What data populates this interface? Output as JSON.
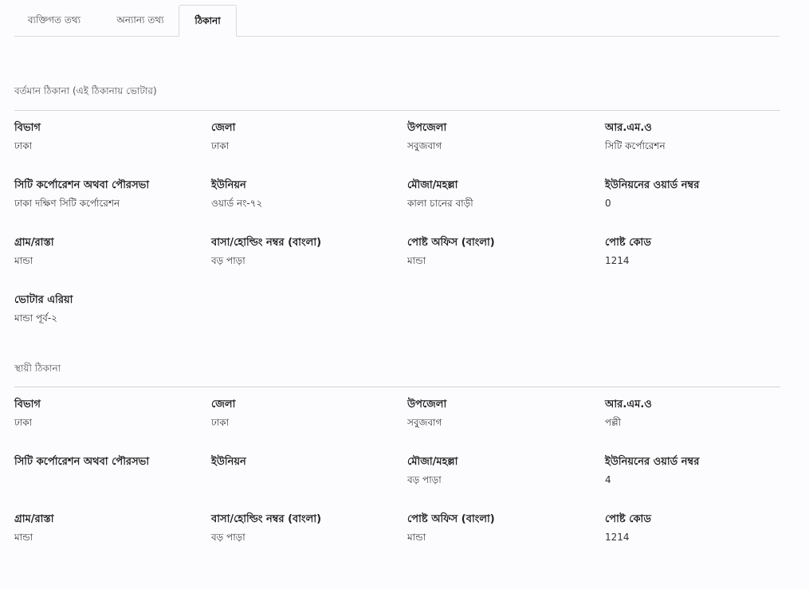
{
  "tabs": [
    {
      "label": "ব্যক্তিগত তথ্য",
      "active": false
    },
    {
      "label": "অন্যান্য তথ্য",
      "active": false
    },
    {
      "label": "ঠিকানা",
      "active": true
    }
  ],
  "present": {
    "title": "বর্তমান ঠিকানা  (এই ঠিকানায় ভোটার)",
    "fields": {
      "division": {
        "label": "বিভাগ",
        "value": "ঢাকা"
      },
      "district": {
        "label": "জেলা",
        "value": "ঢাকা"
      },
      "upazila": {
        "label": "উপজেলা",
        "value": "সবুজবাগ"
      },
      "rmo": {
        "label": "আর.এম.ও",
        "value": "সিটি কর্পোরেশন"
      },
      "city_corp": {
        "label": "সিটি কর্পোরেশন অথবা পৌরসভা",
        "value": "ঢাকা দক্ষিণ সিটি কর্পোরেশন"
      },
      "union": {
        "label": "ইউনিয়ন",
        "value": "ওয়ার্ড নং-৭২"
      },
      "mouza": {
        "label": "মৌজা/মহল্লা",
        "value": "কালা চানের বাড়ী"
      },
      "ward": {
        "label": "ইউনিয়নের ওয়ার্ড নম্বর",
        "value": "0"
      },
      "village": {
        "label": "গ্রাম/রাস্তা",
        "value": "মান্ডা"
      },
      "holding": {
        "label": "বাসা/হোল্ডিং নম্বর (বাংলা)",
        "value": "বড় পাড়া"
      },
      "post_office": {
        "label": "পোষ্ট অফিস (বাংলা)",
        "value": "মান্ডা"
      },
      "post_code": {
        "label": "পোষ্ট কোড",
        "value": "1214"
      },
      "voter_area": {
        "label": "ভোটার এরিয়া",
        "value": "মান্ডা পূর্ব-২"
      }
    }
  },
  "permanent": {
    "title": "স্থায়ী ঠিকানা",
    "fields": {
      "division": {
        "label": "বিভাগ",
        "value": "ঢাকা"
      },
      "district": {
        "label": "জেলা",
        "value": "ঢাকা"
      },
      "upazila": {
        "label": "উপজেলা",
        "value": "সবুজবাগ"
      },
      "rmo": {
        "label": "আর.এম.ও",
        "value": "পল্লী"
      },
      "city_corp": {
        "label": "সিটি কর্পোরেশন অথবা পৌরসভা",
        "value": ""
      },
      "union": {
        "label": "ইউনিয়ন",
        "value": ""
      },
      "mouza": {
        "label": "মৌজা/মহল্লা",
        "value": "বড় পাড়া"
      },
      "ward": {
        "label": "ইউনিয়নের ওয়ার্ড নম্বর",
        "value": "4"
      },
      "village": {
        "label": "গ্রাম/রাস্তা",
        "value": "মান্ডা"
      },
      "holding": {
        "label": "বাসা/হোল্ডিং নম্বর (বাংলা)",
        "value": "বড় পাড়া"
      },
      "post_office": {
        "label": "পোষ্ট অফিস (বাংলা)",
        "value": "মান্ডা"
      },
      "post_code": {
        "label": "পোষ্ট কোড",
        "value": "1214"
      }
    }
  }
}
